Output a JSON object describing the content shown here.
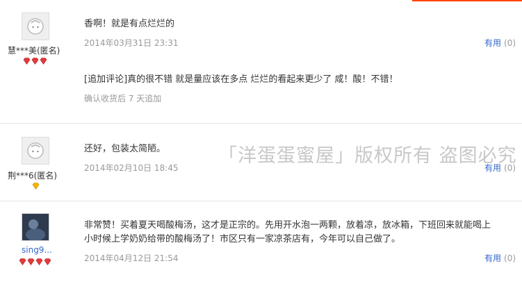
{
  "reviews": [
    {
      "user": "慧***美(匿名)",
      "gems": 3,
      "content": "香啊！就是有点烂烂的",
      "date": "2014年03月31日 23:31",
      "useful_label": "有用",
      "useful_count": "(0)",
      "append_content": "[追加评论]真的很不错 就是量应该在多点 烂烂的看起来更少了 咸！酸！不错！",
      "append_note": "确认收货后 7 天追加"
    },
    {
      "user": "荆***6(匿名)",
      "gems": 1,
      "content": "还好，包装太简陋。",
      "date": "2014年02月10日 18:45",
      "useful_label": "有用",
      "useful_count": "(0)"
    },
    {
      "user": "sing9...",
      "gems": 4,
      "content_line1": "非常赞！买着夏天喝酸梅汤，这才是正宗的。先用开水泡一两颗，放着凉，放冰箱，下班回来就能喝上",
      "content_line2": "小时候上学奶奶给带的酸梅汤了！市区只有一家凉茶店有，今年可以自己做了。",
      "date": "2014年04月12日 21:54",
      "useful_label": "有用",
      "useful_count": "(0)"
    }
  ],
  "watermark": "「洋蛋蛋蜜屋」版权所有 盗图必究",
  "colors": {
    "accent": "#ff4400",
    "link": "#3366cc",
    "gem_red": "#e4393c",
    "gem_gold": "#f5b400"
  }
}
